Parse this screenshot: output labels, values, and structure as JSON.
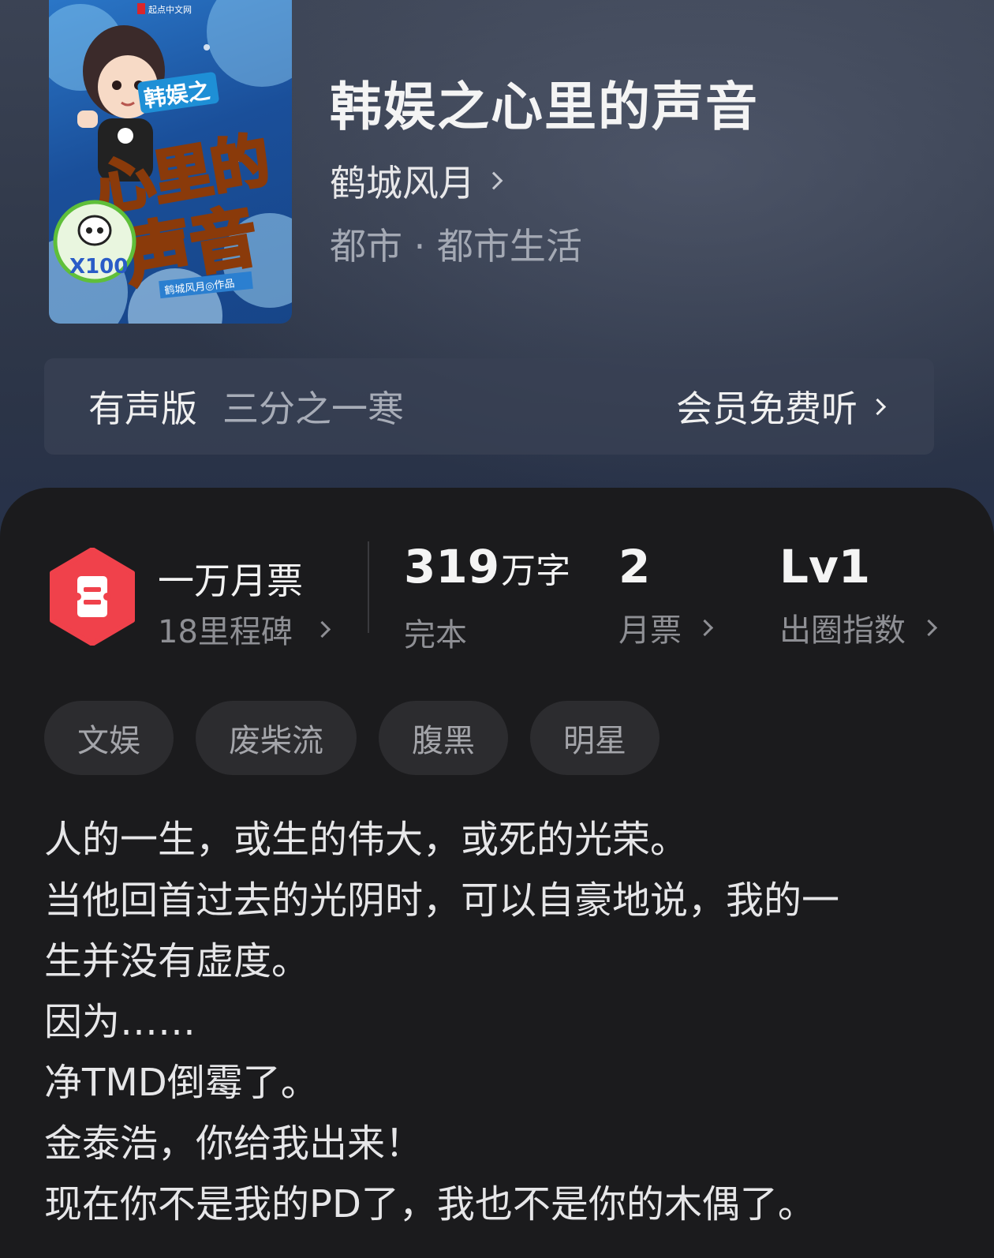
{
  "book": {
    "title": "韩娱之心里的声音",
    "author": "鹤城风月",
    "genre": "都市 · 都市生活",
    "cover": {
      "publisher": "起点中文网",
      "cover_title_line1": "韩娱之",
      "cover_title_line2": "心里的",
      "cover_title_line3": "声音",
      "badge_text": "X100",
      "byline": "鹤城风月◎作品"
    }
  },
  "audio": {
    "label": "有声版",
    "narrator": "三分之一寒",
    "action": "会员免费听"
  },
  "stats": {
    "milestone": {
      "title": "一万月票",
      "subtitle": "18里程碑"
    },
    "words": {
      "value": "319",
      "unit": "万字",
      "label": "完本"
    },
    "monthly_votes": {
      "value": "2",
      "label": "月票"
    },
    "influence": {
      "value": "Lv1",
      "label": "出圈指数"
    }
  },
  "tags": [
    "文娱",
    "废柴流",
    "腹黑",
    "明星"
  ],
  "synopsis": [
    "人的一生，或生的伟大，或死的光荣。",
    "当他回首过去的光阴时，可以自豪地说，我的一",
    "生并没有虚度。",
    "因为……",
    "净TMD倒霉了。",
    "金泰浩，你给我出来！",
    "现在你不是我的PD了，我也不是你的木偶了。"
  ],
  "colors": {
    "accent_red": "#f0414b",
    "panel_bg": "#1b1b1d",
    "header_bg": "#323a4b"
  }
}
